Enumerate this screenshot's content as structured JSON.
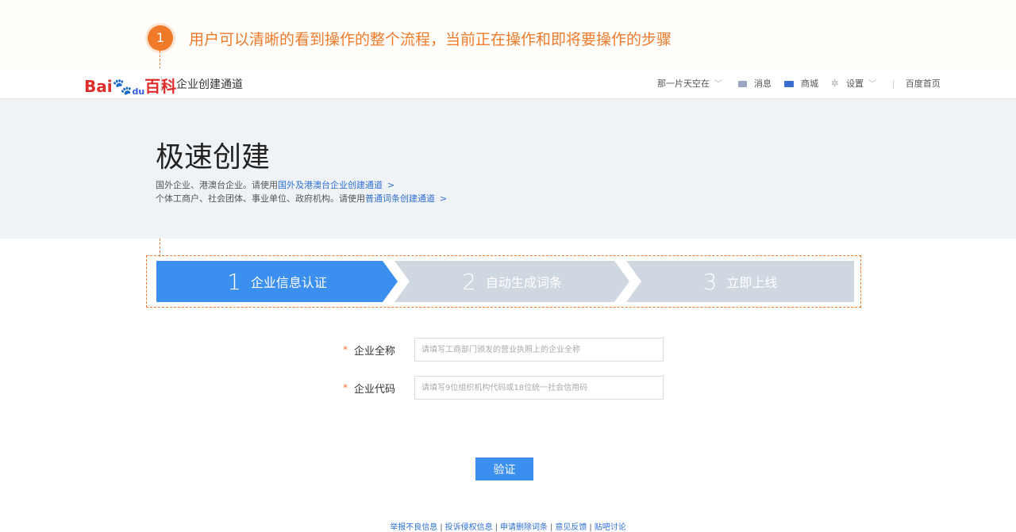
{
  "annotation": {
    "number": "1",
    "text": "用户可以清晰的看到操作的整个流程，当前正在操作和即将要操作的步骤"
  },
  "header": {
    "logo": {
      "bai": "Bai",
      "du": "du",
      "baike": "百科"
    },
    "channel_title": "企业创建通道",
    "nav": {
      "username": "那一片天空在",
      "messages": "消息",
      "shop": "商城",
      "settings": "设置",
      "home": "百度首页"
    }
  },
  "hero": {
    "title": "极速创建",
    "line1_text": "国外企业、港澳台企业。请使用",
    "line1_link": "国外及港澳台企业创建通道",
    "line2_text": "个体工商户、社会团体、事业单位、政府机构。请使用",
    "line2_link": "普通词条创建通道",
    "arrow": ">"
  },
  "steps": [
    {
      "num": "1",
      "label": "企业信息认证",
      "active": true
    },
    {
      "num": "2",
      "label": "自动生成词条",
      "active": false
    },
    {
      "num": "3",
      "label": "立即上线",
      "active": false
    }
  ],
  "form": {
    "required_mark": "*",
    "company_name": {
      "label": "企业全称",
      "placeholder": "请填写工商部门颁发的营业执照上的企业全称"
    },
    "company_code": {
      "label": "企业代码",
      "placeholder": "请填写9位组织机构代码或18位统一社会信用码"
    },
    "verify_button": "验证"
  },
  "footer": {
    "links": [
      "举报不良信息",
      "投诉侵权信息",
      "申请删除词条",
      "意见反馈",
      "贴吧讨论"
    ],
    "separator": "|"
  },
  "colors": {
    "accent_orange": "#f07a2a",
    "primary_blue": "#3b8fef",
    "inactive_step": "#cfd7e1",
    "hero_bg": "#f0f3f6"
  }
}
